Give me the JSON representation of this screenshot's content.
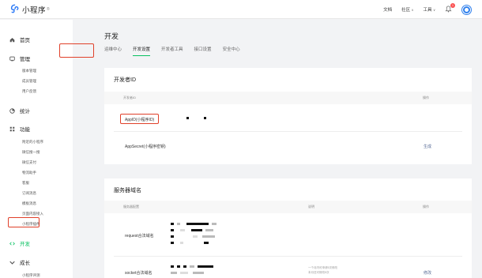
{
  "app": {
    "logo_text": "小程序",
    "logo_sup": "®"
  },
  "topnav": {
    "docs": "文档",
    "community": "社区",
    "tools": "工具",
    "notifications_count": "1"
  },
  "sidebar": {
    "home": "首页",
    "manage": "管理",
    "manage_items": [
      "版本管理",
      "成员管理",
      "用户反馈"
    ],
    "stats": "统计",
    "features": "功能",
    "feature_items": [
      "附近的小程序",
      "微信搜一搜",
      "微信支付",
      "物流助手",
      "客服",
      "订阅消息",
      "模板消息",
      "页面内容接入",
      "小程序插件"
    ],
    "develop": "开发",
    "growth": "成长",
    "growth_items": [
      "小程序评测"
    ]
  },
  "main": {
    "title": "开发",
    "tabs": [
      "运维中心",
      "开发设置",
      "开发者工具",
      "接口设置",
      "安全中心"
    ],
    "active_tab": "开发设置"
  },
  "developer_id": {
    "title": "开发者ID",
    "col_id": "开发者ID",
    "col_action": "操作",
    "rows": [
      {
        "label": "AppID(小程序ID)",
        "action": ""
      },
      {
        "label": "AppSecret(小程序密钥)",
        "action": "生成"
      }
    ]
  },
  "server_domain": {
    "title": "服务器域名",
    "col_config": "服务器配置",
    "col_desc": "说明",
    "col_action": "操作",
    "rows": [
      {
        "label": "request合法域名",
        "desc_lines": [],
        "action": ""
      },
      {
        "label": "socket合法域名",
        "desc_lines": [
          "一个月内可申请5次修改",
          "本月还可修改5次"
        ],
        "action": "修改"
      }
    ]
  },
  "colors": {
    "accent_green": "#07c160",
    "link": "#576b95",
    "highlight_red": "#e0402a"
  }
}
